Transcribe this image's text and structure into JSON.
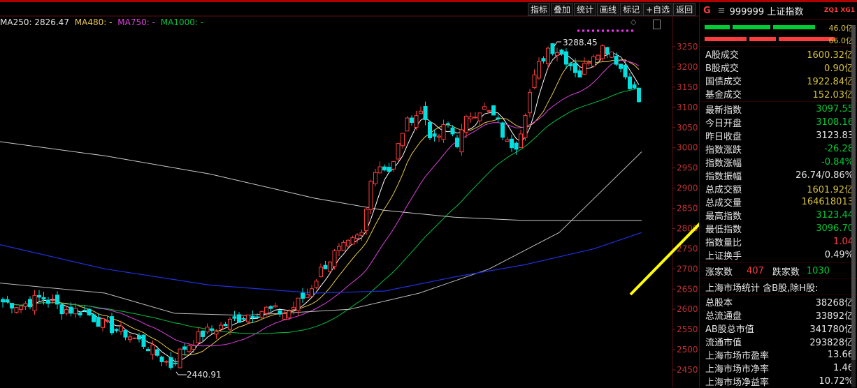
{
  "toolbar": [
    "指标",
    "叠加",
    "统计",
    "画线",
    "标记",
    "+自选",
    "返回"
  ],
  "ma_legend": {
    "ma250": "MA250: 2826.47",
    "ma480": "MA480: -",
    "ma750": "MA750: -",
    "ma1000": "MA1000: -",
    "colors": {
      "ma250": "#e6e6e6",
      "ma480": "#e8c84a",
      "ma750": "#e040e0",
      "ma1000": "#00c040"
    }
  },
  "header": {
    "g_label": "G",
    "menu_icon": "menu-icon",
    "code_name": "999999 上证指数",
    "badge": "ZQ1 XG1"
  },
  "breadth_bars": {
    "up_value": "46.0亿",
    "down_value": "66.0亿"
  },
  "turnover": [
    {
      "label": "A股成交",
      "value": "1600.32亿"
    },
    {
      "label": "B股成交",
      "value": "0.90亿"
    },
    {
      "label": "国债成交",
      "value": "1922.84亿"
    },
    {
      "label": "基金成交",
      "value": "152.03亿"
    }
  ],
  "quote": [
    {
      "label": "最新指数",
      "value": "3097.55",
      "color": "green"
    },
    {
      "label": "今日开盘",
      "value": "3108.16",
      "color": "green"
    },
    {
      "label": "昨日收盘",
      "value": "3123.83",
      "color": "white"
    },
    {
      "label": "指数涨跌",
      "value": "-26.28",
      "color": "green"
    },
    {
      "label": "指数涨幅",
      "value": "-0.84%",
      "color": "green"
    },
    {
      "label": "指数振幅",
      "value": "26.74/0.86%",
      "color": "white"
    },
    {
      "label": "总成交额",
      "value": "1601.92亿",
      "color": "yellow"
    },
    {
      "label": "总成交量",
      "value": "164618013",
      "color": "yellow"
    },
    {
      "label": "最高指数",
      "value": "3123.44",
      "color": "green"
    },
    {
      "label": "最低指数",
      "value": "3096.70",
      "color": "green"
    },
    {
      "label": "指数量比",
      "value": "1.04",
      "color": "red"
    },
    {
      "label": "上证换手",
      "value": "0.49%",
      "color": "white"
    }
  ],
  "updown": {
    "up_label": "涨家数",
    "up_count": "407",
    "down_label": "跌家数",
    "down_count": "1030"
  },
  "market_stats_title": "上海市场统计 含B股,除H股:",
  "market_stats": [
    {
      "label": "总股本",
      "value": "38268亿"
    },
    {
      "label": "总流通盘",
      "value": "33892亿"
    },
    {
      "label": "AB股总市值",
      "value": "341780亿"
    },
    {
      "label": "流通市值",
      "value": "293828亿"
    },
    {
      "label": "上海市场市盈率",
      "value": "13.66"
    },
    {
      "label": "上海市场市净率",
      "value": "1.46"
    },
    {
      "label": "上海市场净益率",
      "value": "10.72%"
    }
  ],
  "chart_data": {
    "type": "candlestick",
    "y_ticks": [
      3250,
      3200,
      3150,
      3100,
      3050,
      3000,
      2950,
      2900,
      2850,
      2800,
      2750,
      2700,
      2650,
      2600,
      2550,
      2500,
      2450
    ],
    "y_range": [
      2420,
      3290
    ],
    "annotations": {
      "high": "3288.45",
      "low": "2440.91"
    },
    "series_colors": {
      "up": "#ff3b3b",
      "down": "#00e0e0"
    },
    "ma_colors": {
      "ma5": "#ffffff",
      "ma10": "#e8c84a",
      "ma20": "#e040e0",
      "ma60": "#00c040",
      "ma120": "#c0c0c0",
      "ma250": "#c8c8c8",
      "ma_blue": "#2030e0"
    },
    "arrow_color": "#ffff00"
  }
}
